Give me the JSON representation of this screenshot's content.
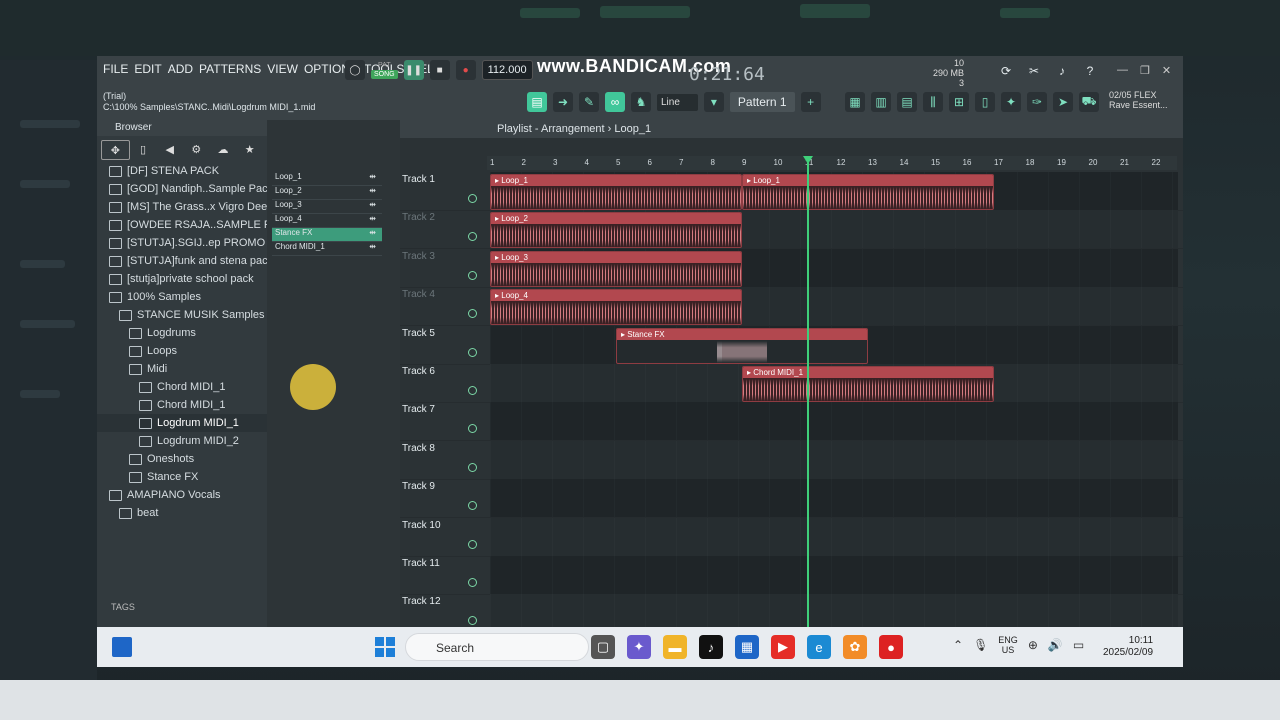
{
  "recorder_watermark": "www.BANDICAM.com",
  "timecode": "0:21:64",
  "menu": [
    "FILE",
    "EDIT",
    "ADD",
    "PATTERNS",
    "VIEW",
    "OPTIONS",
    "TOOLS",
    "HELP"
  ],
  "status": {
    "trial": "(Trial)",
    "path": "C:\\100% Samples\\STANC..Midi\\Logdrum MIDI_1.mid"
  },
  "transport": {
    "pat": "PAT",
    "song": "SONG",
    "tempo": "112.000"
  },
  "resources": {
    "voices": "10",
    "memory": "290 MB",
    "polyphony": "3"
  },
  "cpu": {
    "date_code": "02/05",
    "label": "FLEX",
    "plugin": "Rave Essent..."
  },
  "snap_mode": "Line",
  "pattern_selector": "Pattern 1",
  "browser": {
    "title": "Browser",
    "items": [
      {
        "label": "[DF] STENA PACK",
        "indent": 0
      },
      {
        "label": "[GOD] Nandiph..Sample Pack",
        "indent": 0
      },
      {
        "label": "[MS] The Grass..x Vigro Deep]",
        "indent": 0
      },
      {
        "label": "[OWDEE RSAJA..SAMPLE PACK",
        "indent": 0
      },
      {
        "label": "[STUTJA].SGIJ..ep PROMO PACK",
        "indent": 0
      },
      {
        "label": "[STUTJA]funk and stena pack",
        "indent": 0
      },
      {
        "label": "[stutja]private school pack",
        "indent": 0
      },
      {
        "label": "100% Samples",
        "indent": 0
      },
      {
        "label": "STANCE MUSIK Samples",
        "indent": 1
      },
      {
        "label": "Logdrums",
        "indent": 2
      },
      {
        "label": "Loops",
        "indent": 2
      },
      {
        "label": "Midi",
        "indent": 2
      },
      {
        "label": "Chord MIDI_1",
        "indent": 3
      },
      {
        "label": "Chord MIDI_1",
        "indent": 3
      },
      {
        "label": "Logdrum MIDI_1",
        "indent": 3,
        "selected": true
      },
      {
        "label": "Logdrum MIDI_2",
        "indent": 3
      },
      {
        "label": "Oneshots",
        "indent": 2
      },
      {
        "label": "Stance FX",
        "indent": 2
      },
      {
        "label": "AMAPIANO Vocals",
        "indent": 0
      },
      {
        "label": "beat",
        "indent": 1
      }
    ],
    "tags_label": "TAGS"
  },
  "channels": [
    "Loop_1",
    "Loop_2",
    "Loop_3",
    "Loop_4",
    "Stance FX",
    "Chord MIDI_1"
  ],
  "playlist": {
    "title": "Playlist - Arrangement",
    "current_clip": "Loop_1",
    "ruler": [
      "1",
      "2",
      "3",
      "4",
      "5",
      "6",
      "7",
      "8",
      "9",
      "10",
      "11",
      "12",
      "13",
      "14",
      "15",
      "16",
      "17",
      "18",
      "19",
      "20",
      "21",
      "22"
    ],
    "tracks": [
      {
        "name": "Track 1"
      },
      {
        "name": "Track 2"
      },
      {
        "name": "Track 3"
      },
      {
        "name": "Track 4"
      },
      {
        "name": "Track 5"
      },
      {
        "name": "Track 6"
      },
      {
        "name": "Track 7"
      },
      {
        "name": "Track 8"
      },
      {
        "name": "Track 9"
      },
      {
        "name": "Track 10"
      },
      {
        "name": "Track 11"
      },
      {
        "name": "Track 12"
      }
    ],
    "clips": [
      {
        "track": 0,
        "name": "Loop_1",
        "start": 1,
        "end": 9
      },
      {
        "track": 0,
        "name": "Loop_1",
        "start": 9,
        "end": 17
      },
      {
        "track": 1,
        "name": "Loop_2",
        "start": 1,
        "end": 9
      },
      {
        "track": 2,
        "name": "Loop_3",
        "start": 1,
        "end": 9
      },
      {
        "track": 3,
        "name": "Loop_4",
        "start": 1,
        "end": 9
      },
      {
        "track": 4,
        "name": "Stance FX",
        "start": 5,
        "end": 13,
        "fx": true
      },
      {
        "track": 5,
        "name": "Chord MIDI_1",
        "start": 9,
        "end": 17
      }
    ],
    "playhead_bar": 11.1
  },
  "taskbar": {
    "search": "Search",
    "lang_top": "ENG",
    "lang_bottom": "US",
    "time": "10:11",
    "date": "2025/02/09"
  }
}
